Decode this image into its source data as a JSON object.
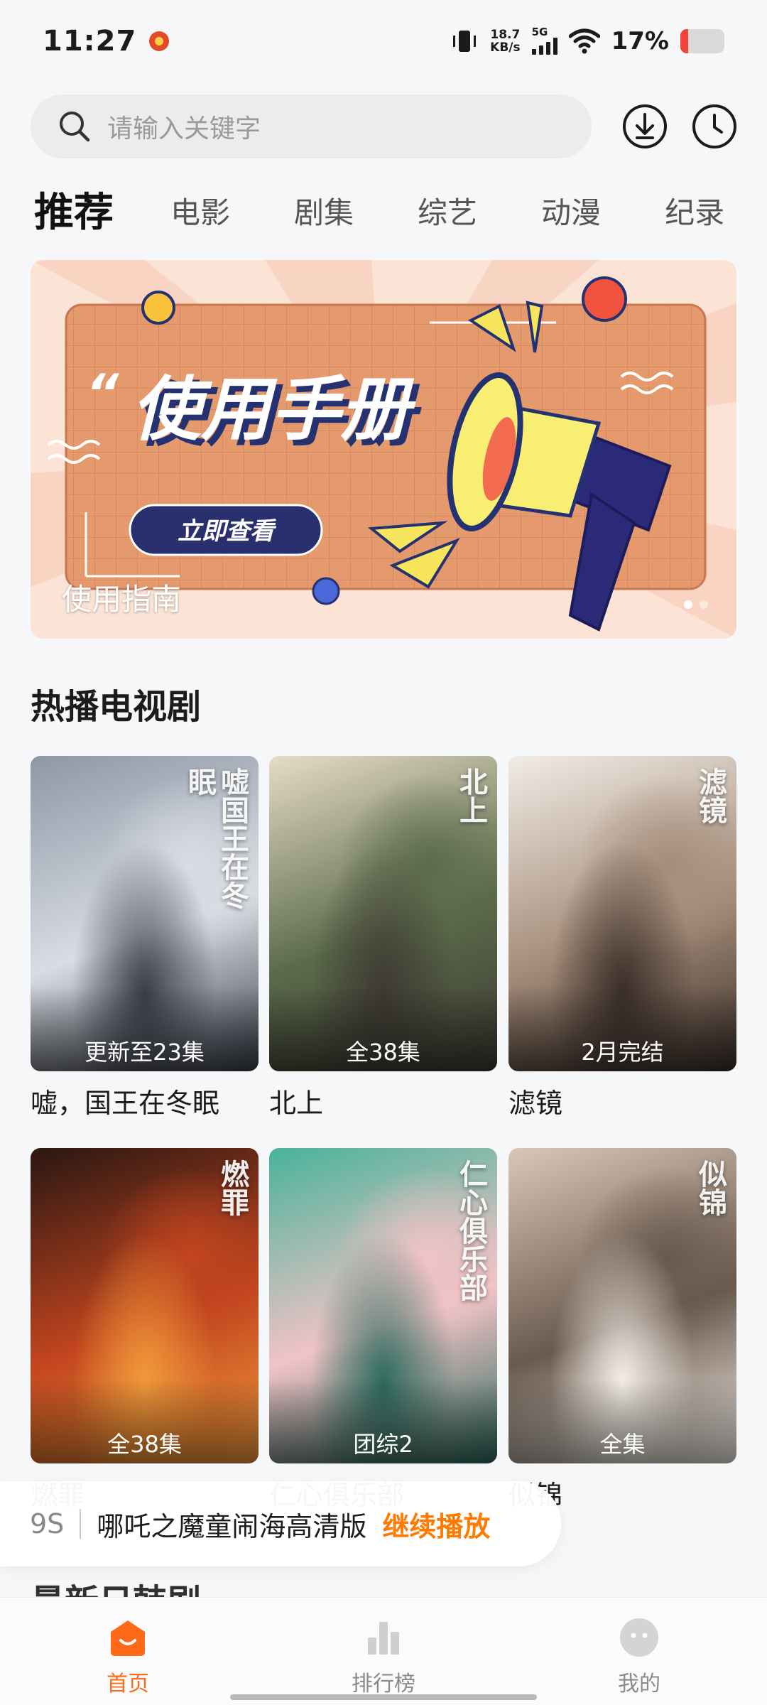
{
  "status_bar": {
    "time": "11:27",
    "net_speed_value": "18.7",
    "net_speed_unit": "KB/s",
    "network_type": "5G",
    "battery_percent": "17%",
    "battery_level": 0.17
  },
  "search": {
    "placeholder": "请输入关键字"
  },
  "tabs": [
    "推荐",
    "电影",
    "剧集",
    "综艺",
    "动漫",
    "纪录"
  ],
  "banner": {
    "headline": "使用手册",
    "button_text": "立即查看",
    "caption": "使用指南",
    "slide_count": 2,
    "active_slide": 0
  },
  "section": {
    "title": "热播电视剧",
    "items": [
      {
        "title": "嘘，国王在冬眠",
        "badge": "更新至23集",
        "poster_text": "嘘国王在冬眠",
        "colors": [
          "#8d97a6",
          "#d9dde3",
          "#3a3f4a"
        ]
      },
      {
        "title": "北上",
        "badge": "全38集",
        "poster_text": "北上",
        "colors": [
          "#e7dcc7",
          "#5b6b4a",
          "#3e3a33"
        ]
      },
      {
        "title": "滤镜",
        "badge": "2月完结",
        "poster_text": "滤镜",
        "colors": [
          "#f1ece6",
          "#a58d7a",
          "#3b2f29"
        ]
      },
      {
        "title": "燃罪",
        "badge": "全38集",
        "poster_text": "燃罪",
        "colors": [
          "#2a1712",
          "#c2451f",
          "#f29a3a"
        ]
      },
      {
        "title": "仁心俱乐部",
        "badge": "团综2",
        "poster_text": "仁心俱乐部",
        "colors": [
          "#49b39a",
          "#f1c3c6",
          "#2e6b5e"
        ]
      },
      {
        "title": "似锦",
        "badge": "全集",
        "poster_text": "似锦",
        "colors": [
          "#d9c7b6",
          "#6a5a4e",
          "#f5efe8"
        ]
      }
    ]
  },
  "resume": {
    "time": "9S",
    "title": "哪吒之魔童闹海高清版",
    "action": "继续播放"
  },
  "next_section_title": "最新日韩剧",
  "bottom_nav": [
    {
      "label": "首页",
      "icon": "home-icon",
      "active": true
    },
    {
      "label": "排行榜",
      "icon": "chart-icon",
      "active": false
    },
    {
      "label": "我的",
      "icon": "profile-icon",
      "active": false
    }
  ],
  "accent_color": "#ff6a1a"
}
